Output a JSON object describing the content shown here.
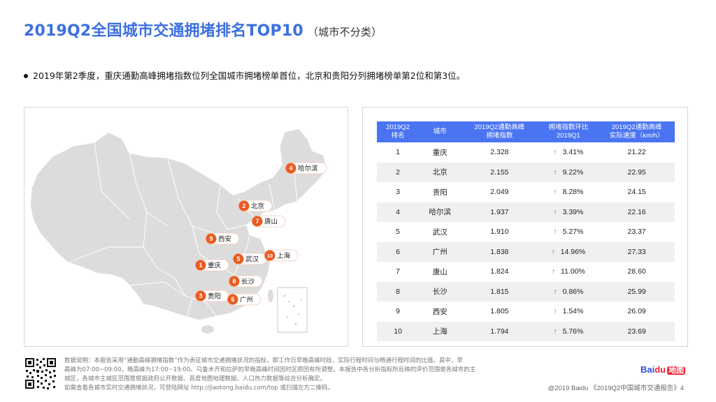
{
  "header": {
    "title": "2019Q2全国城市交通拥堵排名TOP10",
    "subtitle": "（城市不分类）"
  },
  "summary": "2019年第2季度，重庆通勤高峰拥堵指数位列全国城市拥堵榜单首位，北京和贵阳分列拥堵榜单第2位和第3位。",
  "map": {
    "markers": [
      {
        "rank": "1",
        "city": "重庆"
      },
      {
        "rank": "2",
        "city": "北京"
      },
      {
        "rank": "3",
        "city": "贵阳"
      },
      {
        "rank": "4",
        "city": "哈尔滨"
      },
      {
        "rank": "5",
        "city": "武汉"
      },
      {
        "rank": "6",
        "city": "广州"
      },
      {
        "rank": "7",
        "city": "唐山"
      },
      {
        "rank": "8",
        "city": "长沙"
      },
      {
        "rank": "9",
        "city": "西安"
      },
      {
        "rank": "10",
        "city": "上海"
      }
    ],
    "colors": {
      "land": "#dcdcdc",
      "border": "#ffffff",
      "marker": "#e95b20"
    }
  },
  "table": {
    "headers": [
      "2019Q2\n排名",
      "城市",
      "2019Q2通勤高峰\n拥堵指数",
      "拥堵指数环比\n2019Q1",
      "2019Q2通勤高峰\n实际速度（km/h）"
    ],
    "rows": [
      {
        "rank": "1",
        "city": "重庆",
        "index": "2.328",
        "change": "3.41%",
        "speed": "21.22"
      },
      {
        "rank": "2",
        "city": "北京",
        "index": "2.155",
        "change": "9.22%",
        "speed": "22.95"
      },
      {
        "rank": "3",
        "city": "贵阳",
        "index": "2.049",
        "change": "8.28%",
        "speed": "24.15"
      },
      {
        "rank": "4",
        "city": "哈尔滨",
        "index": "1.937",
        "change": "3.39%",
        "speed": "22.16"
      },
      {
        "rank": "5",
        "city": "武汉",
        "index": "1.910",
        "change": "5.27%",
        "speed": "23.37"
      },
      {
        "rank": "6",
        "city": "广州",
        "index": "1.838",
        "change": "14.96%",
        "speed": "27.33"
      },
      {
        "rank": "7",
        "city": "唐山",
        "index": "1.824",
        "change": "11.00%",
        "speed": "28.60"
      },
      {
        "rank": "8",
        "city": "长沙",
        "index": "1.815",
        "change": "0.86%",
        "speed": "25.99"
      },
      {
        "rank": "9",
        "city": "西安",
        "index": "1.805",
        "change": "1.54%",
        "speed": "26.09"
      },
      {
        "rank": "10",
        "city": "上海",
        "index": "1.794",
        "change": "5.76%",
        "speed": "23.69"
      }
    ],
    "arrow_symbol": "↑",
    "colors": {
      "header_bg": "#4a74f2",
      "arrow": "#e24a2b"
    }
  },
  "footer": {
    "note_lines": [
      "数据说明：本报告采用“通勤高峰拥堵指数”作为表征城市交通拥堵状况的指标，即工作日早晚高峰时段，实际行程时间与畅通行程时间的比值。其中，早",
      "高峰为07:00~09:00，晚高峰为17:00~19:00。乌鲁木齐和拉萨的早晚高峰时间因时区原因有所调整。本报告中各分析指标所反映的评价范围是各城市的主",
      "城区，各城市主城区范围是根据政府公开数据、百度地图地理数据、人口热力数据等综合分析确定。",
      "如需查看各城市实时交通拥堵状况，可登陆网址 http://jiaotong.baidu.com/top 或扫描左方二维码。"
    ],
    "copyright": "@2019 Baidu 《2019Q2中国城市交通报告》4",
    "logo_bai": "Bai",
    "logo_du": "du",
    "logo_map": "地图"
  }
}
